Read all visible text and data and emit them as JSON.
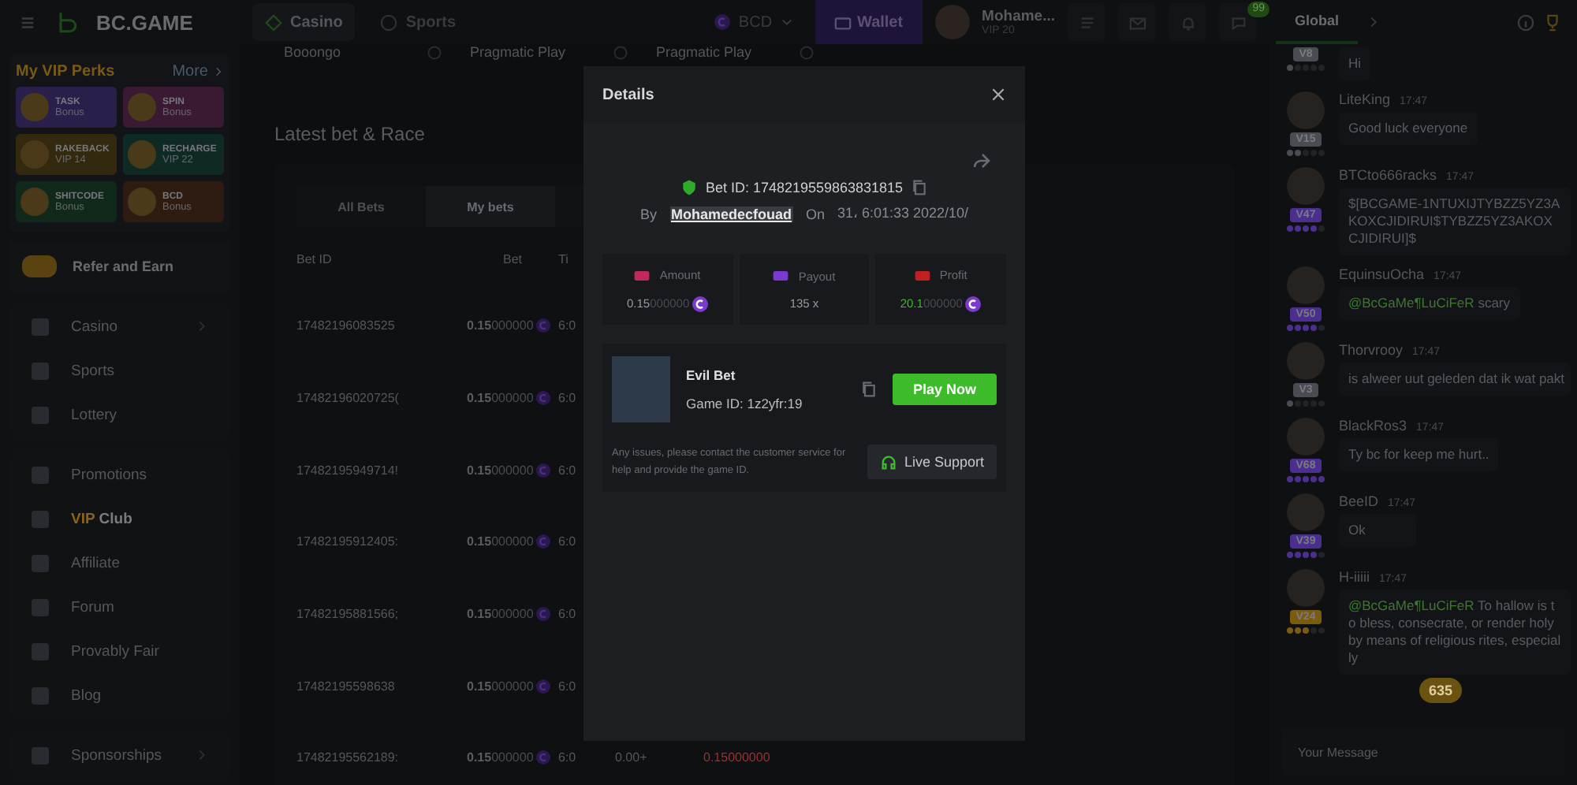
{
  "sidebar": {
    "logo": "BC.GAME",
    "vip_perks": {
      "title": "My VIP Perks",
      "more": "More",
      "perks": [
        {
          "name": "TASK",
          "sub": "Bonus",
          "color": "#2a1f4a"
        },
        {
          "name": "SPIN",
          "sub": "Bonus",
          "color": "#3a1a33"
        },
        {
          "name": "RAKEBACK",
          "sub": "VIP 14",
          "color": "#33290f"
        },
        {
          "name": "RECHARGE",
          "sub": "VIP 22",
          "color": "#0f2a25"
        },
        {
          "name": "SHITCODE",
          "sub": "Bonus",
          "color": "#10291a"
        },
        {
          "name": "BCD",
          "sub": "Bonus",
          "color": "#2e1c12"
        }
      ]
    },
    "refer": "Refer and Earn",
    "nav_groups": [
      [
        {
          "label": "Casino",
          "expandable": true,
          "selected": false
        },
        {
          "label": "Sports",
          "expandable": false,
          "selected": false
        },
        {
          "label": "Lottery",
          "expandable": false,
          "selected": false
        }
      ],
      [
        {
          "label": "Promotions",
          "expandable": false,
          "selected": false
        },
        {
          "accent": "VIP",
          "label": "Club",
          "expandable": false,
          "selected": true
        },
        {
          "label": "Affiliate",
          "expandable": false,
          "selected": false
        },
        {
          "label": "Forum",
          "expandable": false,
          "selected": false
        },
        {
          "label": "Provably Fair",
          "expandable": false,
          "selected": false
        },
        {
          "label": "Blog",
          "expandable": false,
          "selected": false
        }
      ],
      [
        {
          "label": "Sponsorships",
          "expandable": true,
          "selected": false
        }
      ]
    ]
  },
  "top_bar": {
    "tabs": [
      {
        "label": "Casino",
        "selected": true
      },
      {
        "label": "Sports",
        "selected": false
      }
    ],
    "currency": "BCD",
    "wallet": "Wallet",
    "user": {
      "name": "Mohame...",
      "vip": "VIP 20"
    },
    "chat_badge": "99"
  },
  "providers": [
    "Booongo",
    "Pragmatic Play",
    "Pragmatic Play"
  ],
  "bets": {
    "title": "Latest bet & Race",
    "tabs": [
      {
        "label": "All Bets",
        "selected": false
      },
      {
        "label": "My bets",
        "selected": true
      }
    ],
    "columns": [
      "Bet ID",
      "Bet",
      "Ti"
    ],
    "rows": [
      {
        "id": "17482196083525",
        "bet_main": "0.15",
        "bet_rest": "000000",
        "time": "6:0"
      },
      {
        "id": "17482196020725(",
        "bet_main": "0.15",
        "bet_rest": "000000",
        "time": "6:0"
      },
      {
        "id": "17482195949714!",
        "bet_main": "0.15",
        "bet_rest": "000000",
        "time": "6:0"
      },
      {
        "id": "17482195912405:",
        "bet_main": "0.15",
        "bet_rest": "000000",
        "time": "6:0"
      },
      {
        "id": "17482195881566;",
        "bet_main": "0.15",
        "bet_rest": "000000",
        "time": "6:0"
      },
      {
        "id": "17482195598638",
        "bet_main": "0.15",
        "bet_rest": "000000",
        "time": "6:0"
      },
      {
        "id": "17482195562189:",
        "bet_main": "0.15",
        "bet_rest": "000000",
        "time": "6:0",
        "column_4": "0.00+",
        "column_5": "0.15000000"
      }
    ]
  },
  "modal": {
    "title": "Details",
    "bet_id": "Bet ID: 1748219559863831815",
    "by": "By",
    "user": "Mohamedecfouad",
    "on": "On",
    "date": "31، 6:01:33 2022/10/",
    "stats": [
      {
        "kind": "amount",
        "label": "Amount",
        "main": "0.15",
        "rest": "000000",
        "coin": true
      },
      {
        "kind": "payout",
        "label": "Payout",
        "main": "135 x",
        "coin": false
      },
      {
        "kind": "profit",
        "label": "Profit",
        "main": "20.1",
        "rest": "000000",
        "coin": true
      }
    ],
    "game": {
      "name": "Evil Bet",
      "game_id": "Game ID: 1z2yfr:19",
      "play": "Play Now"
    },
    "note": "Any issues, please contact the customer service for help and provide the game ID.",
    "support": "Live Support"
  },
  "chat": {
    "tabs": [
      {
        "label": "Global",
        "selected": true
      }
    ],
    "messages": [
      {
        "level": "V8",
        "color": "#4a4b53",
        "stars": 1,
        "text": "Hi"
      },
      {
        "level": "V15",
        "color": "#4a4b53",
        "stars": 2,
        "name": "LiteKing",
        "time": "17:47",
        "text": "Good luck everyone"
      },
      {
        "level": "V47",
        "color": "#4b2f8f",
        "stars": 4,
        "name": "BTCto666racks",
        "time": "17:47",
        "text": "$[BCGAME-1NTUXIJTYBZZ5YZ3AKOXCJIDIRUI$TYBZZ5YZ3AKOXCJIDIRUI]$"
      },
      {
        "level": "V50",
        "color": "#4b2f8f",
        "stars": 4,
        "name": "EquinsuOcha",
        "time": "17:47",
        "mention": "@BcGaMe¶LuCiFeR",
        "text": "scary"
      },
      {
        "level": "V3",
        "color": "#4a4b53",
        "stars": 1,
        "name": "Thorvrooy",
        "time": "17:47",
        "text": "is alweer uut geleden dat ik wat pakt"
      },
      {
        "level": "V68",
        "color": "#4b2f8f",
        "stars": 5,
        "name": "BlackRos3",
        "time": "17:47",
        "text": "Ty bc for keep me hurt.."
      },
      {
        "level": "V39",
        "color": "#4b2f8f",
        "stars": 4,
        "name": "BeeID",
        "time": "17:47",
        "text": "Ok"
      },
      {
        "level": "V24",
        "color": "#7a5c10",
        "stars": 3,
        "name": "H-iiiii",
        "time": "17:47",
        "mention": "@BcGaMe¶LuCiFeR",
        "text": "To hallow is to bless, consecrate, or render holy by means of religious rites, especially"
      }
    ],
    "unread": "635",
    "placeholder": "Your Message"
  }
}
